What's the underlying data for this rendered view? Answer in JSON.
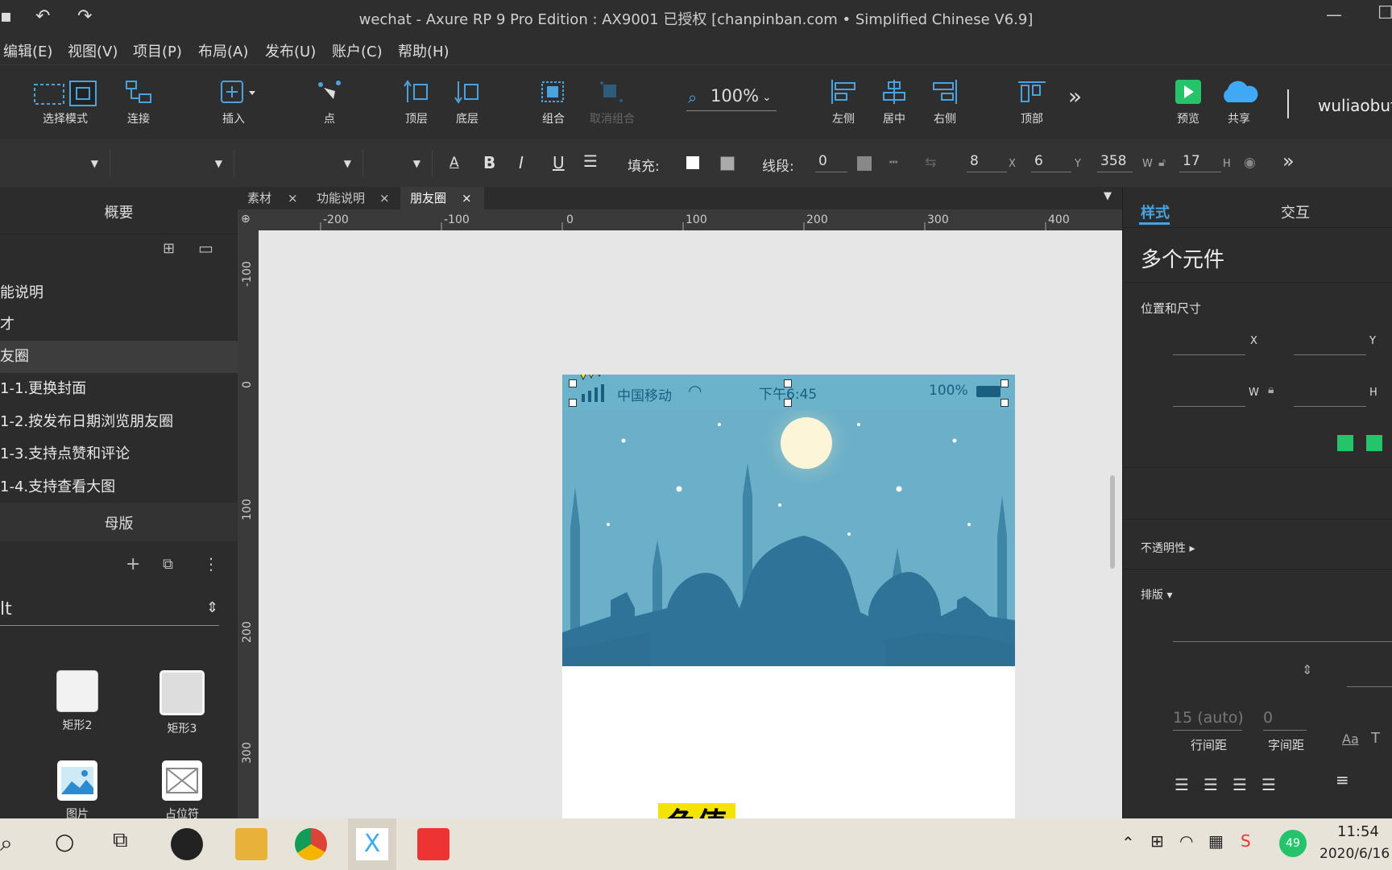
{
  "titlebar": {
    "title": "wechat - Axure RP 9 Pro Edition : AX9001 已授权    [chanpinban.com • Simplified Chinese V6.9]",
    "min": "—",
    "max": "☐"
  },
  "menu": [
    "编辑(E)",
    "视图(V)",
    "项目(P)",
    "布局(A)",
    "发布(U)",
    "账户(C)",
    "帮助(H)"
  ],
  "toolbar": {
    "select_mode": "选择模式",
    "connect": "连接",
    "insert": "插入",
    "point": "点",
    "top_layer": "顶层",
    "bottom_layer": "底层",
    "group": "组合",
    "ungroup": "取消组合",
    "zoom": "100%",
    "align_left": "左侧",
    "align_center": "居中",
    "align_right": "右侧",
    "align_top": "顶部",
    "more": "»",
    "preview": "预览",
    "share": "共享",
    "user": "wuliaobuf"
  },
  "formatbar": {
    "fill_label": "填充:",
    "stroke_label": "线段:",
    "stroke_value": "0",
    "x_value": "8",
    "x_label": "X",
    "y_value": "6",
    "y_label": "Y",
    "w_value": "358",
    "w_label": "W",
    "h_value": "17",
    "h_label": "H",
    "bold": "B",
    "italic": "I",
    "underline": "U",
    "font_color": "A"
  },
  "left_panel": {
    "outline_title": "概要",
    "pages": [
      "能说明",
      "才",
      "友圈",
      "1-1.更换封面",
      "1-2.按发布日期浏览朋友圈",
      "1-3.支持点赞和评论",
      "1-4.支持查看大图"
    ],
    "selected_page_index": 2,
    "masters_title": "母版",
    "library_name": "lt",
    "widgets": [
      "矩形2",
      "矩形3",
      "图片",
      "占位符"
    ]
  },
  "tabs": [
    {
      "label": "素材",
      "close": "×"
    },
    {
      "label": "功能说明",
      "close": "×"
    },
    {
      "label": "朋友圈",
      "close": "×",
      "active": true
    }
  ],
  "ruler": {
    "h_ticks": [
      "-200",
      "-100",
      "0",
      "100",
      "200",
      "300",
      "400"
    ],
    "v_ticks": [
      "-100",
      "0",
      "100",
      "200",
      "300"
    ]
  },
  "phone": {
    "carrier": "中国移动",
    "time": "下午6:45",
    "battery": "100%"
  },
  "right_panel": {
    "tab_style": "样式",
    "tab_interaction": "交互",
    "heading": "多个元件",
    "pos_size": "位置和尺寸",
    "x_label": "X",
    "y_label": "Y",
    "w_label": "W",
    "h_label": "H",
    "opacity": "不透明性 ▸",
    "typography": "排版 ▾",
    "line_height_value": "15 (auto)",
    "line_height_label": "行间距",
    "letter_spacing_value": "0",
    "letter_spacing_label": "字间距",
    "aa": "Aa"
  },
  "taskbar": {
    "time": "11:54",
    "date": "2020/6/16",
    "badge": "49"
  },
  "caption": "色值"
}
